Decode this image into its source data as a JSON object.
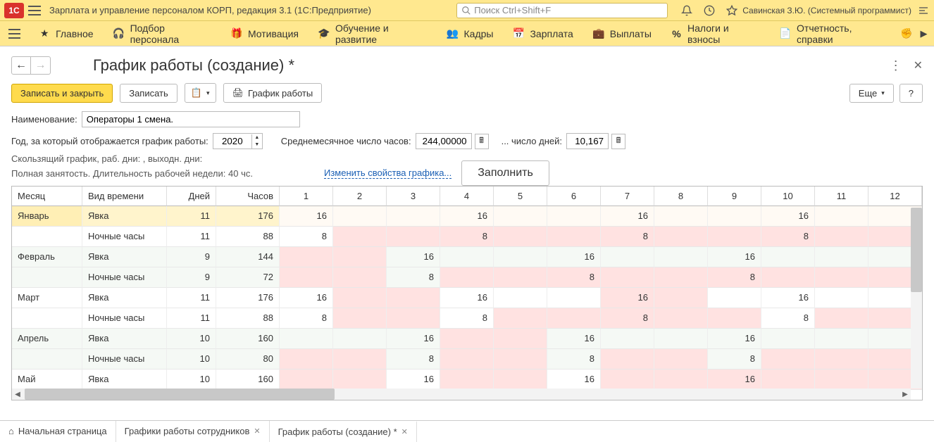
{
  "app": {
    "title": "Зарплата и управление персоналом КОРП, редакция 3.1  (1С:Предприятие)",
    "search_placeholder": "Поиск Ctrl+Shift+F",
    "user": "Савинская З.Ю. (Системный программист)"
  },
  "menu": {
    "main": "Главное",
    "recruit": "Подбор персонала",
    "motivation": "Мотивация",
    "training": "Обучение и развитие",
    "hr": "Кадры",
    "salary": "Зарплата",
    "payments": "Выплаты",
    "taxes": "Налоги и взносы",
    "reports": "Отчетность, справки"
  },
  "page": {
    "title": "График работы (создание) *"
  },
  "toolbar": {
    "save_close": "Записать и закрыть",
    "save": "Записать",
    "print": "График работы",
    "more": "Еще",
    "help": "?"
  },
  "form": {
    "name_label": "Наименование:",
    "name_value": "Операторы 1 смена.",
    "year_label": "Год, за который отображается график работы:",
    "year_value": "2020",
    "avg_hours_label": "Среднемесячное число часов:",
    "avg_hours_value": "244,00000",
    "days_label": "... число дней:",
    "days_value": "10,167",
    "info1": "Скользящий график, раб. дни: , выходн. дни:",
    "info2": "Полная занятость. Длительность рабочей недели: 40 чс.",
    "change_link": "Изменить свойства графика...",
    "fill_btn": "Заполнить"
  },
  "table": {
    "headers": {
      "month": "Месяц",
      "type": "Вид времени",
      "days": "Дней",
      "hours": "Часов",
      "d1": "1",
      "d2": "2",
      "d3": "3",
      "d4": "4",
      "d5": "5",
      "d6": "6",
      "d7": "7",
      "d8": "8",
      "d9": "9",
      "d10": "10",
      "d11": "11",
      "d12": "12"
    },
    "rows": [
      {
        "month": "Январь",
        "type": "Явка",
        "days": "11",
        "hours": "176",
        "cells": {
          "1": "16",
          "4": "16",
          "7": "16",
          "10": "16"
        },
        "pink": [],
        "cream": [
          2,
          3,
          4,
          5,
          6,
          7,
          8
        ],
        "hl": true
      },
      {
        "month": "",
        "type": "Ночные часы",
        "days": "11",
        "hours": "88",
        "cells": {
          "1": "8",
          "4": "8",
          "7": "8",
          "10": "8"
        },
        "pink": [
          2,
          3,
          4,
          5,
          6,
          7,
          8,
          9,
          10,
          11,
          12
        ]
      },
      {
        "month": "Февраль",
        "type": "Явка",
        "days": "9",
        "hours": "144",
        "cells": {
          "3": "16",
          "6": "16",
          "9": "16"
        },
        "pink": [
          1,
          2
        ],
        "zebra": true
      },
      {
        "month": "",
        "type": "Ночные часы",
        "days": "9",
        "hours": "72",
        "cells": {
          "3": "8",
          "6": "8",
          "9": "8"
        },
        "pink": [
          1,
          2,
          4,
          5,
          6,
          7,
          8,
          9,
          10,
          11,
          12
        ],
        "zebra": true
      },
      {
        "month": "Март",
        "type": "Явка",
        "days": "11",
        "hours": "176",
        "cells": {
          "1": "16",
          "4": "16",
          "7": "16",
          "10": "16"
        },
        "pink": [
          2,
          3,
          7,
          8
        ]
      },
      {
        "month": "",
        "type": "Ночные часы",
        "days": "11",
        "hours": "88",
        "cells": {
          "1": "8",
          "4": "8",
          "7": "8",
          "10": "8"
        },
        "pink": [
          2,
          3,
          5,
          6,
          7,
          8,
          9,
          11,
          12
        ]
      },
      {
        "month": "Апрель",
        "type": "Явка",
        "days": "10",
        "hours": "160",
        "cells": {
          "3": "16",
          "6": "16",
          "9": "16"
        },
        "pink": [
          4,
          5
        ],
        "zebra": true
      },
      {
        "month": "",
        "type": "Ночные часы",
        "days": "10",
        "hours": "80",
        "cells": {
          "3": "8",
          "6": "8",
          "9": "8"
        },
        "pink": [
          1,
          2,
          4,
          5,
          7,
          8,
          10,
          11,
          12
        ],
        "zebra": true
      },
      {
        "month": "Май",
        "type": "Явка",
        "days": "10",
        "hours": "160",
        "cells": {
          "3": "16",
          "6": "16",
          "9": "16"
        },
        "pink": [
          1,
          2,
          4,
          5,
          7,
          8,
          9,
          10,
          11,
          12
        ]
      }
    ]
  },
  "tabs": {
    "home": "Начальная страница",
    "schedules": "Графики работы сотрудников",
    "current": "График работы (создание) *"
  }
}
